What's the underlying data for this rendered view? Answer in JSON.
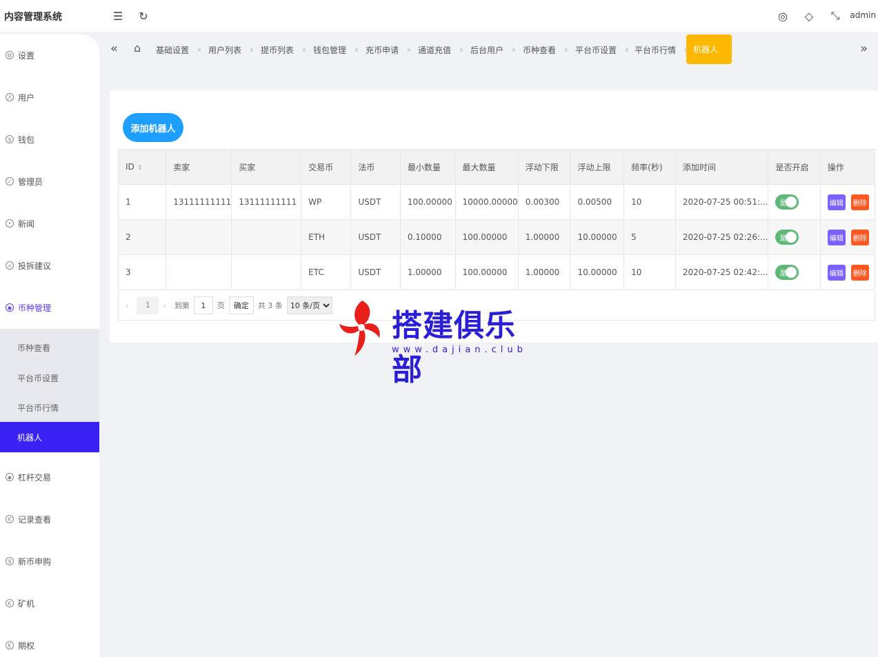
{
  "app": {
    "title": "内容管理系统",
    "user": "admin"
  },
  "header_icons": [
    "menu-fold-icon",
    "refresh-icon",
    "theme-icon",
    "tag-icon",
    "fullscreen-icon"
  ],
  "sidebar": {
    "items": [
      {
        "label": "设置",
        "icon": "gear-icon"
      },
      {
        "label": "用户",
        "icon": "user-icon"
      },
      {
        "label": "钱包",
        "icon": "wallet-icon"
      },
      {
        "label": "管理员",
        "icon": "shield-icon"
      },
      {
        "label": "新闻",
        "icon": "news-icon"
      },
      {
        "label": "投拆建议",
        "icon": "link-icon"
      },
      {
        "label": "币种管理",
        "icon": "diamond-icon"
      }
    ],
    "submenu": [
      {
        "label": "币种查看"
      },
      {
        "label": "平台币设置"
      },
      {
        "label": "平台币行情"
      },
      {
        "label": "机器人"
      }
    ],
    "items_after": [
      {
        "label": "杠杆交易",
        "icon": "diamond-icon"
      },
      {
        "label": "记录查看",
        "icon": "record-icon"
      },
      {
        "label": "新币申购",
        "icon": "coin-icon"
      },
      {
        "label": "矿机",
        "icon": "miner-icon"
      },
      {
        "label": "期权",
        "icon": "option-icon"
      }
    ]
  },
  "tabs": [
    {
      "label": "基础设置"
    },
    {
      "label": "用户列表"
    },
    {
      "label": "提币列表"
    },
    {
      "label": "钱包管理"
    },
    {
      "label": "充币申请"
    },
    {
      "label": "通道充值"
    },
    {
      "label": "后台用户"
    },
    {
      "label": "币种查看"
    },
    {
      "label": "平台币设置"
    },
    {
      "label": "平台币行情"
    },
    {
      "label": "机器人"
    }
  ],
  "tab_close": "x",
  "main": {
    "add_button": "添加机器人",
    "columns": [
      "ID",
      "卖家",
      "买家",
      "交易币",
      "法币",
      "最小数量",
      "最大数量",
      "浮动下限",
      "浮动上限",
      "频率(秒)",
      "添加时间",
      "是否开启",
      "操作"
    ],
    "rows": [
      {
        "id": "1",
        "seller": "13111111111",
        "buyer": "13111111111",
        "coin": "WP",
        "fiat": "USDT",
        "min": "100.00000",
        "max": "10000.00000",
        "float_low": "0.00300",
        "float_high": "0.00500",
        "freq": "10",
        "time": "2020-07-25 00:51:...",
        "enabled": "是"
      },
      {
        "id": "2",
        "seller": "",
        "buyer": "",
        "coin": "ETH",
        "fiat": "USDT",
        "min": "0.10000",
        "max": "100.00000",
        "float_low": "1.00000",
        "float_high": "10.00000",
        "freq": "5",
        "time": "2020-07-25 02:26:...",
        "enabled": "是"
      },
      {
        "id": "3",
        "seller": "",
        "buyer": "",
        "coin": "ETC",
        "fiat": "USDT",
        "min": "1.00000",
        "max": "100.00000",
        "float_low": "1.00000",
        "float_high": "10.00000",
        "freq": "10",
        "time": "2020-07-25 02:42:...",
        "enabled": "是"
      }
    ],
    "edit_label": "编辑",
    "delete_label": "删除"
  },
  "pager": {
    "current": "1",
    "goto_label": "到第",
    "goto_value": "1",
    "page_unit": "页",
    "confirm": "确定",
    "total": "共 3 条",
    "page_size": "10 条/页"
  },
  "watermark": {
    "text": "搭建俱乐部",
    "url": "www.dajian.club"
  },
  "colors": {
    "accent": "#3a22f5",
    "tab_active": "#ffb800",
    "add_button": "#1e9fff",
    "switch_on": "#5fb878",
    "edit": "#7b61ff",
    "delete": "#ff5722"
  }
}
